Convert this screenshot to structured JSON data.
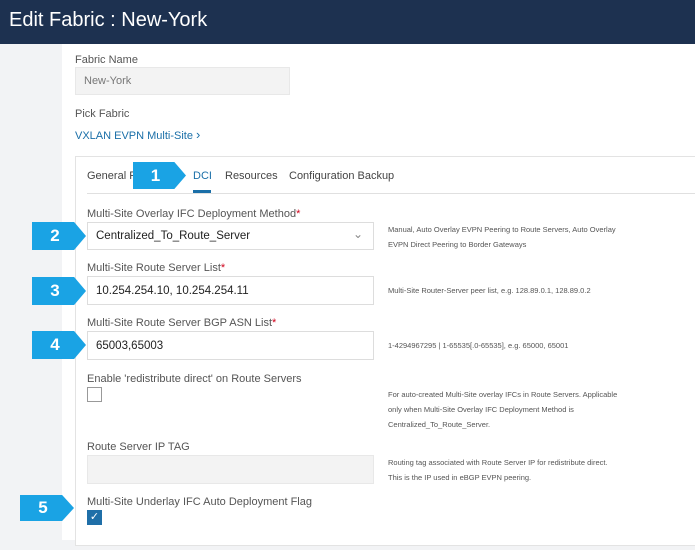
{
  "header": {
    "title": "Edit Fabric : New-York"
  },
  "fabric_name": {
    "label": "Fabric Name",
    "value": "New-York"
  },
  "pick_fabric": {
    "label": "Pick Fabric",
    "value": "VXLAN EVPN Multi-Site",
    "icon": "chevron-right-icon"
  },
  "tabs": [
    {
      "label": "General P"
    },
    {
      "label": "DCI",
      "active": true
    },
    {
      "label": "Resources"
    },
    {
      "label": "Configuration Backup"
    }
  ],
  "callouts": [
    "1",
    "2",
    "3",
    "4",
    "5"
  ],
  "fields": {
    "deploy_method": {
      "label": "Multi-Site Overlay IFC Deployment Method",
      "required": "*",
      "value": "Centralized_To_Route_Server",
      "help": "Manual, Auto Overlay EVPN Peering to Route Servers, Auto Overlay EVPN Direct Peering to Border Gateways"
    },
    "rs_list": {
      "label": "Multi-Site Route Server List",
      "required": "*",
      "value": "10.254.254.10, 10.254.254.11",
      "help": "Multi-Site Router-Server peer list, e.g. 128.89.0.1, 128.89.0.2"
    },
    "rs_asn": {
      "label": "Multi-Site Route Server BGP ASN List",
      "required": "*",
      "value": "65003,65003",
      "help": "1-4294967295 | 1-65535[.0-65535], e.g. 65000, 65001"
    },
    "redistribute": {
      "label": "Enable 'redistribute direct' on Route Servers",
      "checked": false,
      "help": "For auto-created Multi-Site overlay IFCs in Route Servers. Applicable only when Multi-Site Overlay IFC Deployment Method is Centralized_To_Route_Server."
    },
    "ip_tag": {
      "label": "Route Server IP TAG",
      "value": "",
      "help": "Routing tag associated with Route Server IP for redistribute direct. This is the IP used in eBGP EVPN peering."
    },
    "underlay": {
      "label": "Multi-Site Underlay IFC Auto Deployment Flag",
      "checked": true
    }
  },
  "colors": {
    "header": "#1d3150",
    "accent": "#1a6fa8",
    "callout": "#1aa3e4",
    "required": "#d0021b"
  }
}
